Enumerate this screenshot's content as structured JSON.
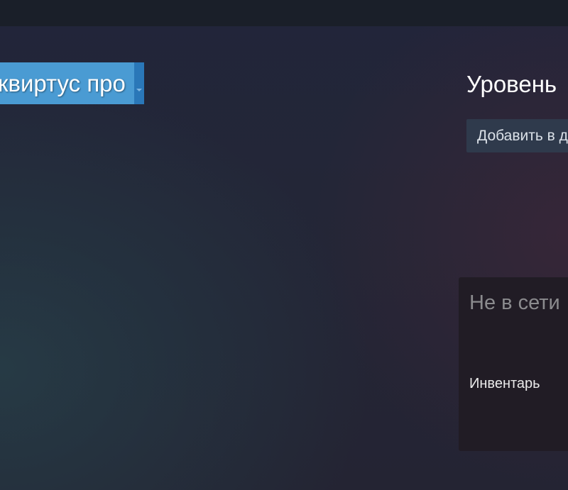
{
  "profile": {
    "name": "квиртус про",
    "level_label": "Уровень",
    "add_friend_label": "Добавить в друзья"
  },
  "status": {
    "text": "Не в сети",
    "inventory_label": "Инвентарь"
  },
  "colors": {
    "name_tag_bg": "#4a9bd3",
    "name_tag_dropdown": "#2a77b8",
    "top_bar": "#1a1f29",
    "button_bg": "#2f3a4c",
    "status_panel_bg": "#211c25"
  },
  "icons": {
    "name_dropdown": "chevron-down-icon"
  }
}
